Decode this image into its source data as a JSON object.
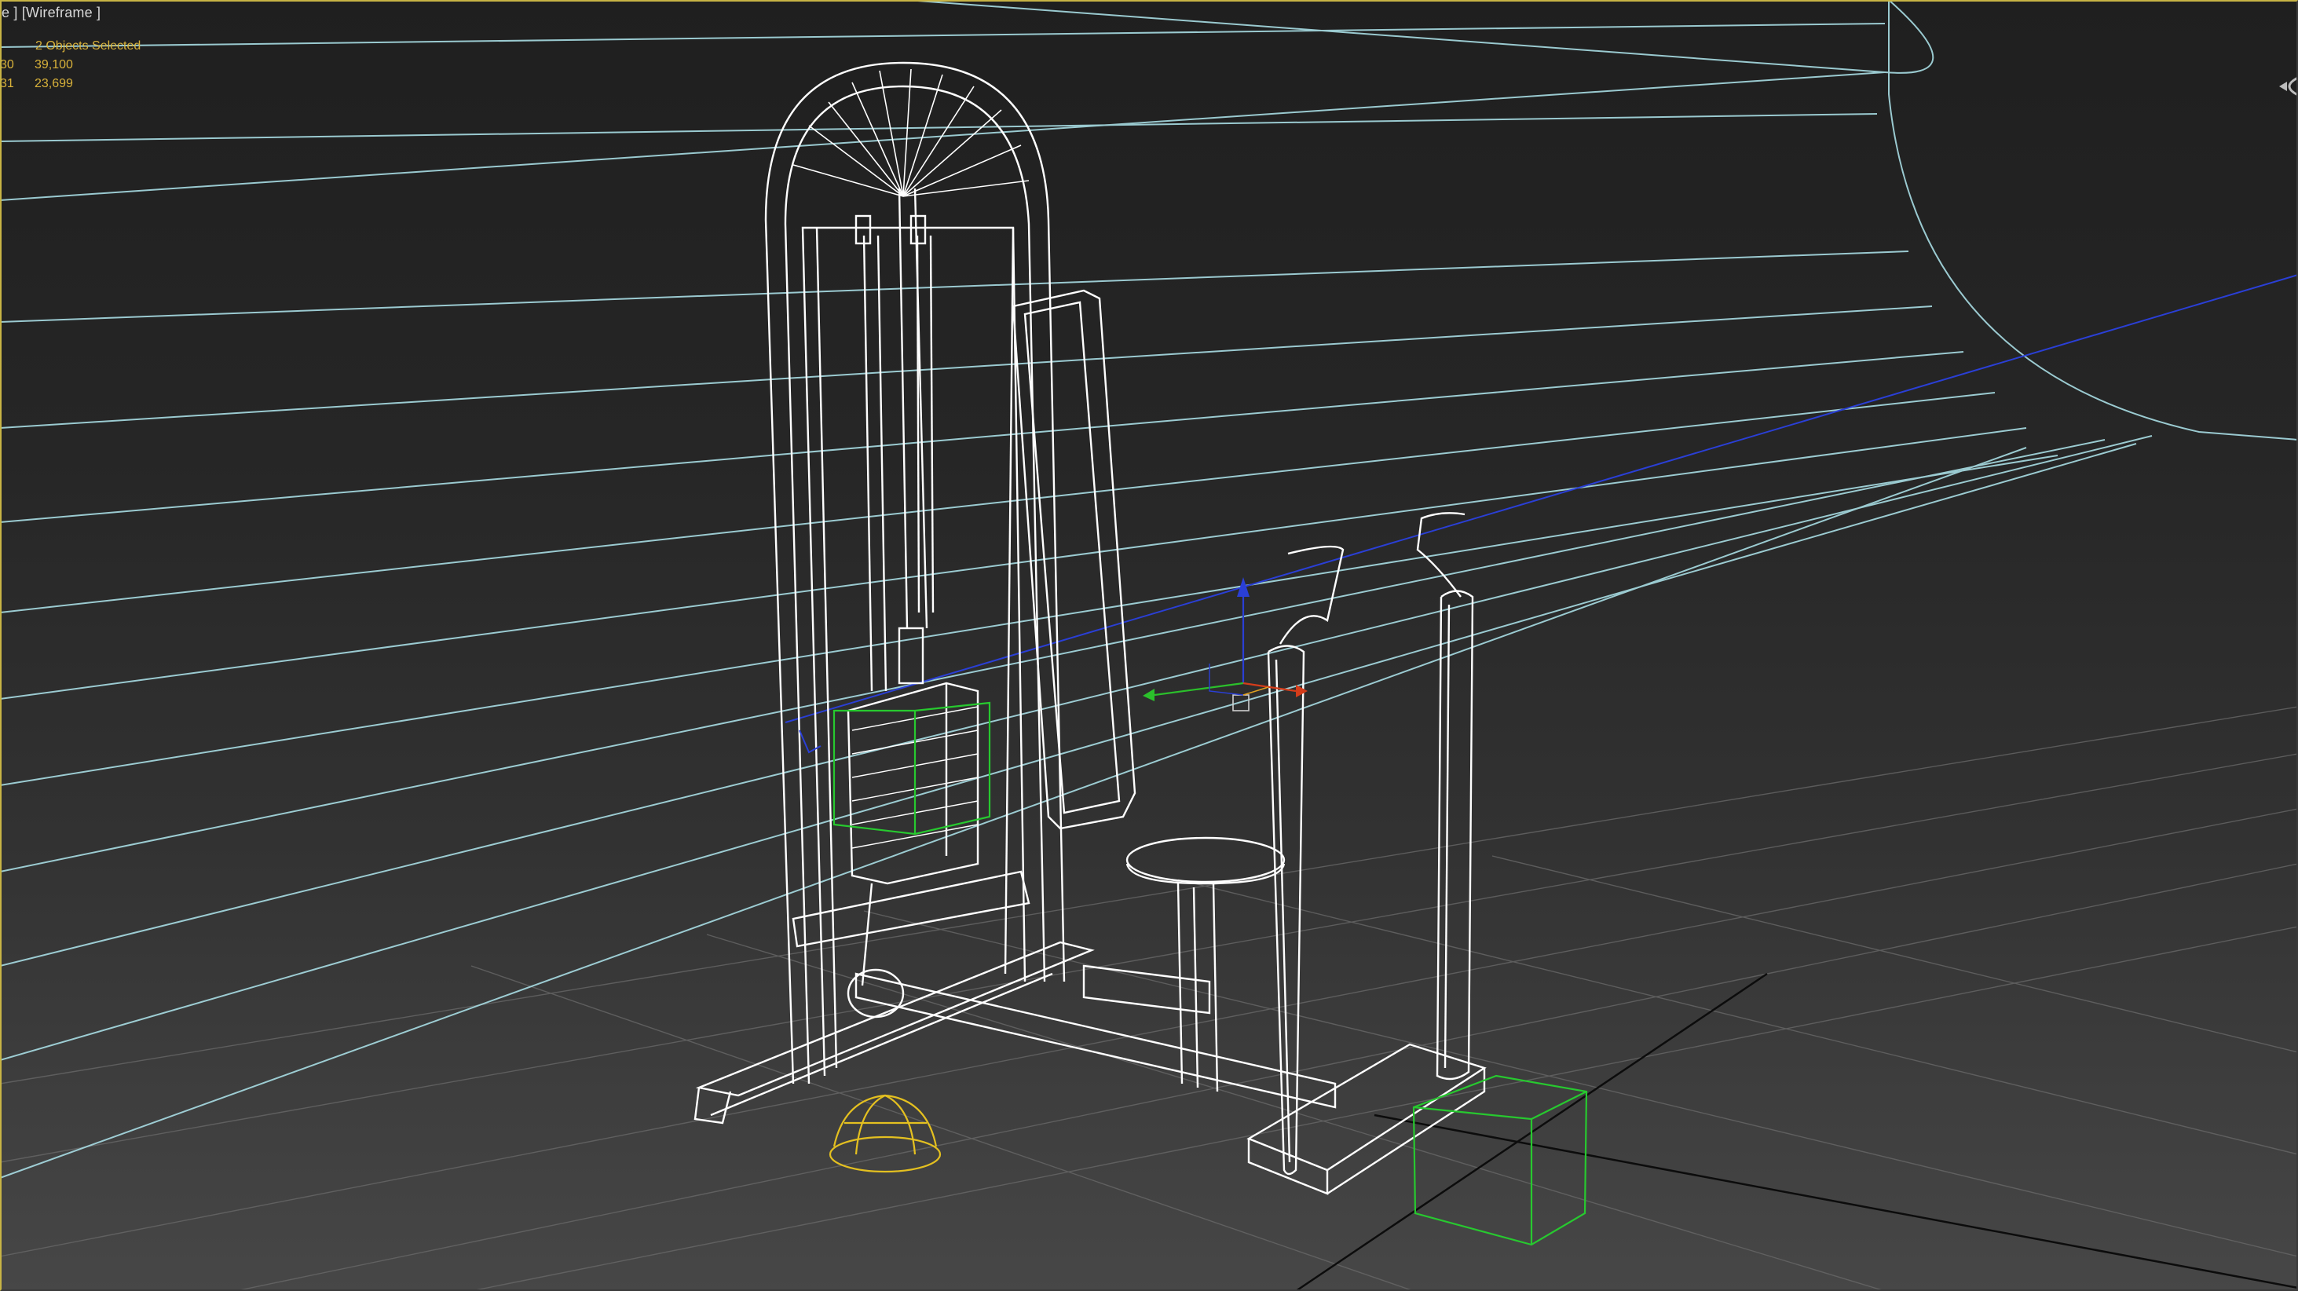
{
  "viewport": {
    "label": "e ] [Wireframe ]",
    "stats": {
      "header": "2 Objects Selected",
      "rows": [
        {
          "key": "30",
          "value": "39,100"
        },
        {
          "key": "31",
          "value": "23,699"
        }
      ]
    }
  },
  "colors": {
    "background_top": "#1f1f1f",
    "background_bottom": "#474747",
    "wire_white": "#ffffff",
    "wire_cyan": "#9fd8e0",
    "selection_green": "#27c92f",
    "helper_yellow": "#e4c020",
    "stats_yellow": "#d9b23a",
    "axis_x": "#d43c1a",
    "axis_y": "#2bc02b",
    "axis_z": "#2a3fd6",
    "grid": "#6c6c6c",
    "border_active": "#c8b445"
  },
  "icons": {
    "view_cube": "viewcube-icon",
    "transform_gizmo": "transform-gizmo-icon"
  }
}
